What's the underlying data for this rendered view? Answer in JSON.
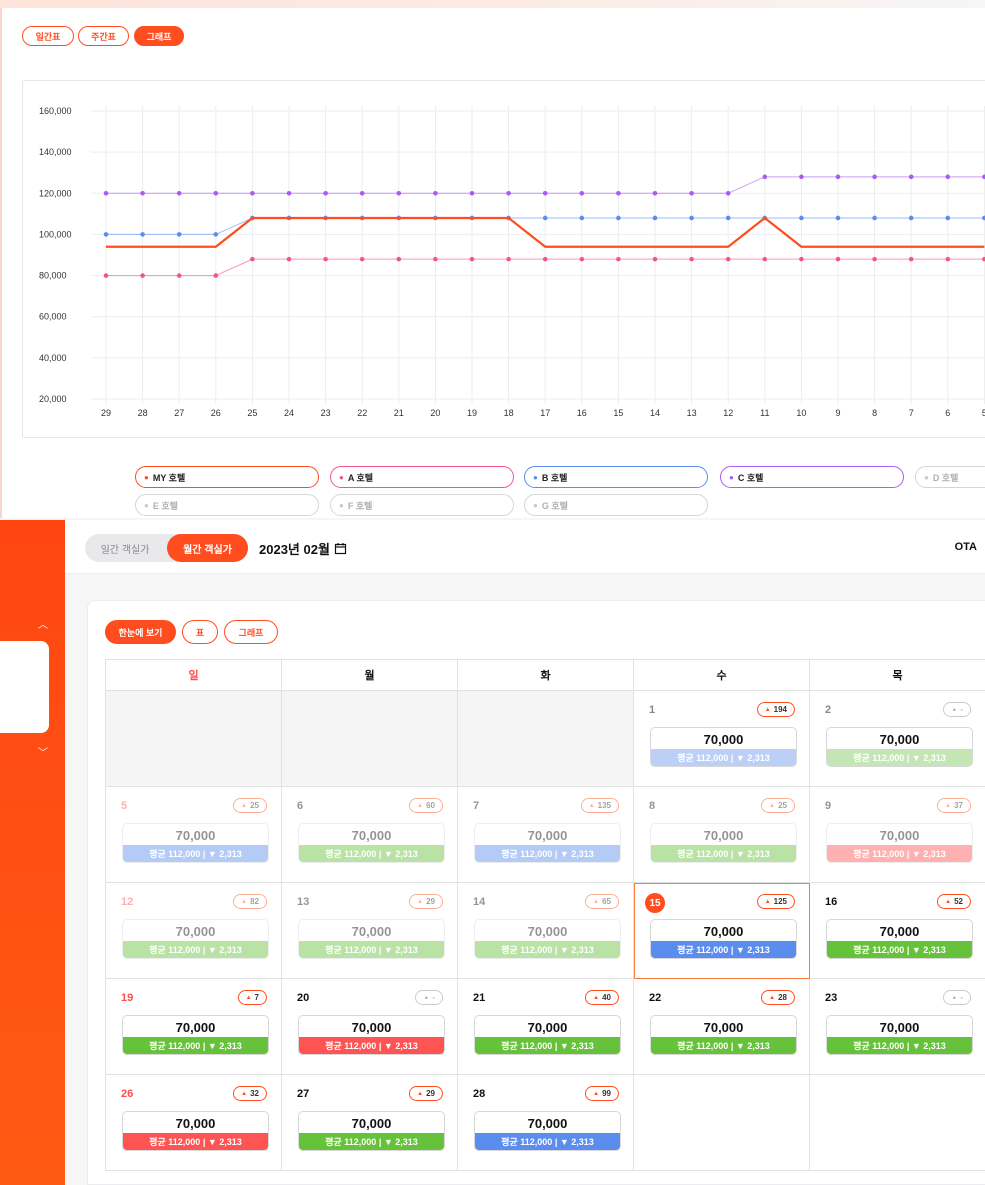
{
  "top_tabs": [
    "일간표",
    "주간표",
    "그래프"
  ],
  "top_active": 2,
  "chart_data": {
    "type": "line",
    "x": [
      "29",
      "28",
      "27",
      "26",
      "25",
      "24",
      "23",
      "22",
      "21",
      "20",
      "19",
      "18",
      "17",
      "16",
      "15",
      "14",
      "13",
      "12",
      "11",
      "10",
      "9",
      "8",
      "7",
      "6",
      "5"
    ],
    "yticks": [
      "160,000",
      "140,000",
      "120,000",
      "100,000",
      "80,000",
      "60,000",
      "40,000",
      "20,000"
    ],
    "ylim": [
      20000,
      160000
    ],
    "series": [
      {
        "name": "MY 호텔",
        "color": "#ff4d1f",
        "values": [
          94000,
          94000,
          94000,
          94000,
          108000,
          108000,
          108000,
          108000,
          108000,
          108000,
          108000,
          108000,
          94000,
          94000,
          94000,
          94000,
          94000,
          94000,
          108000,
          94000,
          94000,
          94000,
          94000,
          94000,
          94000
        ]
      },
      {
        "name": "A 호텔",
        "color": "#f0568c",
        "values": [
          80000,
          80000,
          80000,
          80000,
          88000,
          88000,
          88000,
          88000,
          88000,
          88000,
          88000,
          88000,
          88000,
          88000,
          88000,
          88000,
          88000,
          88000,
          88000,
          88000,
          88000,
          88000,
          88000,
          88000,
          88000
        ]
      },
      {
        "name": "B 호텔",
        "color": "#5b8def",
        "values": [
          100000,
          100000,
          100000,
          100000,
          108000,
          108000,
          108000,
          108000,
          108000,
          108000,
          108000,
          108000,
          108000,
          108000,
          108000,
          108000,
          108000,
          108000,
          108000,
          108000,
          108000,
          108000,
          108000,
          108000,
          108000
        ]
      },
      {
        "name": "C 호텔",
        "color": "#a95cf0",
        "values": [
          120000,
          120000,
          120000,
          120000,
          120000,
          120000,
          120000,
          120000,
          120000,
          120000,
          120000,
          120000,
          120000,
          120000,
          120000,
          120000,
          120000,
          120000,
          128000,
          128000,
          128000,
          128000,
          128000,
          128000,
          128000
        ]
      }
    ],
    "legend": [
      {
        "label": "MY 호텔",
        "color": "#ff4d1f",
        "active": true
      },
      {
        "label": "A 호텔",
        "color": "#f0568c",
        "active": true
      },
      {
        "label": "B 호텔",
        "color": "#5b8def",
        "active": true
      },
      {
        "label": "C 호텔",
        "color": "#a95cf0",
        "active": true
      },
      {
        "label": "D 호텔",
        "color": "#c8c8c8",
        "active": false
      },
      {
        "label": "E 호텔",
        "color": "#c8c8c8",
        "active": false
      },
      {
        "label": "F 호텔",
        "color": "#c8c8c8",
        "active": false
      },
      {
        "label": "G 호텔",
        "color": "#c8c8c8",
        "active": false
      }
    ]
  },
  "header": {
    "toggle_daily": "일간 객실가",
    "toggle_monthly": "월간 객실가",
    "month": "2023년 02월",
    "ota": "OTA"
  },
  "cal_tabs": [
    "한눈에 보기",
    "표",
    "그래프"
  ],
  "weekdays": [
    "일",
    "월",
    "화",
    "수",
    "목"
  ],
  "colors": {
    "blue_light": "#bcd0f7",
    "green_light": "#c4e6b5",
    "red_light": "#f7b9b9",
    "blue": "#5b8def",
    "green": "#66c23a",
    "red": "#ff5454",
    "accent": "#ff4d1f"
  },
  "weeks": [
    [
      null,
      null,
      null,
      {
        "day": "1",
        "bell": "194",
        "price": "70,000",
        "avg": "평균 112,000 | ▼ 2,313",
        "color": "blue_light",
        "faded": false,
        "numColor": "#888"
      },
      {
        "day": "2",
        "bell": "-",
        "price": "70,000",
        "avg": "평균 112,000 | ▼ 2,313",
        "color": "green_light",
        "faded": false,
        "numColor": "#888"
      }
    ],
    [
      {
        "day": "5",
        "bell": "25",
        "price": "70,000",
        "avg": "평균 112,000 | ▼ 2,313",
        "color": "blue",
        "faded": true,
        "numColor": "#ff4d4d"
      },
      {
        "day": "6",
        "bell": "60",
        "price": "70,000",
        "avg": "평균 112,000 | ▼ 2,313",
        "color": "green",
        "faded": true,
        "numColor": "#111"
      },
      {
        "day": "7",
        "bell": "135",
        "price": "70,000",
        "avg": "평균 112,000 | ▼ 2,313",
        "color": "blue",
        "faded": true,
        "numColor": "#111"
      },
      {
        "day": "8",
        "bell": "25",
        "price": "70,000",
        "avg": "평균 112,000 | ▼ 2,313",
        "color": "green",
        "faded": true,
        "numColor": "#111"
      },
      {
        "day": "9",
        "bell": "37",
        "price": "70,000",
        "avg": "평균 112,000 | ▼ 2,313",
        "color": "red",
        "faded": true,
        "numColor": "#111"
      }
    ],
    [
      {
        "day": "12",
        "bell": "82",
        "price": "70,000",
        "avg": "평균 112,000 | ▼ 2,313",
        "color": "green",
        "faded": true,
        "numColor": "#ff4d4d"
      },
      {
        "day": "13",
        "bell": "29",
        "price": "70,000",
        "avg": "평균 112,000 | ▼ 2,313",
        "color": "green",
        "faded": true,
        "numColor": "#111"
      },
      {
        "day": "14",
        "bell": "65",
        "price": "70,000",
        "avg": "평균 112,000 | ▼ 2,313",
        "color": "green",
        "faded": true,
        "numColor": "#111"
      },
      {
        "day": "15",
        "bell": "125",
        "price": "70,000",
        "avg": "평균 112,000 | ▼ 2,313",
        "color": "blue",
        "faded": false,
        "selected": true,
        "numColor": "#fff"
      },
      {
        "day": "16",
        "bell": "52",
        "price": "70,000",
        "avg": "평균 112,000 | ▼ 2,313",
        "color": "green",
        "faded": false,
        "numColor": "#111"
      }
    ],
    [
      {
        "day": "19",
        "bell": "7",
        "price": "70,000",
        "avg": "평균 112,000 | ▼ 2,313",
        "color": "green",
        "faded": false,
        "numColor": "#ff4d4d"
      },
      {
        "day": "20",
        "bell": "-",
        "price": "70,000",
        "avg": "평균 112,000 | ▼ 2,313",
        "color": "red",
        "faded": false,
        "numColor": "#111"
      },
      {
        "day": "21",
        "bell": "40",
        "price": "70,000",
        "avg": "평균 112,000 | ▼ 2,313",
        "color": "green",
        "faded": false,
        "numColor": "#111"
      },
      {
        "day": "22",
        "bell": "28",
        "price": "70,000",
        "avg": "평균 112,000 | ▼ 2,313",
        "color": "green",
        "faded": false,
        "numColor": "#111"
      },
      {
        "day": "23",
        "bell": "-",
        "price": "70,000",
        "avg": "평균 112,000 | ▼ 2,313",
        "color": "green",
        "faded": false,
        "numColor": "#111"
      }
    ],
    [
      {
        "day": "26",
        "bell": "32",
        "price": "70,000",
        "avg": "평균 112,000 | ▼ 2,313",
        "color": "red",
        "faded": false,
        "numColor": "#ff4d4d"
      },
      {
        "day": "27",
        "bell": "29",
        "price": "70,000",
        "avg": "평균 112,000 | ▼ 2,313",
        "color": "green",
        "faded": false,
        "numColor": "#111"
      },
      {
        "day": "28",
        "bell": "99",
        "price": "70,000",
        "avg": "평균 112,000 | ▼ 2,313",
        "color": "blue",
        "faded": false,
        "numColor": "#111"
      },
      null,
      null
    ]
  ],
  "icons": {
    "calendar": "calendar-icon",
    "bell": "bell-icon",
    "chevron_up": "chevron-up-icon",
    "chevron_down": "chevron-down-icon"
  }
}
